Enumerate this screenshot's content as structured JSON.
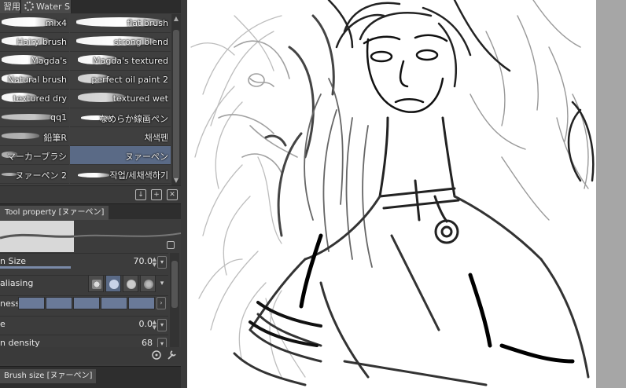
{
  "tabs": [
    {
      "label": "習用"
    },
    {
      "label": "Water S"
    }
  ],
  "brushes": [
    {
      "left": "mix4",
      "right": "flat brush"
    },
    {
      "left": "Hairy brush",
      "right": "strong blend"
    },
    {
      "left": "Magda's",
      "right": "Magda's textured"
    },
    {
      "left": "Natural brush",
      "right": "perfect oil paint 2"
    },
    {
      "left": "textured dry",
      "right": "textured wet"
    },
    {
      "left": "qq1",
      "right": "なめらか線画ペン"
    },
    {
      "left": "鉛筆R",
      "right": "채색펜"
    },
    {
      "left": "マーカーブラシ",
      "right": "ヌァーペン"
    },
    {
      "left": "ヌァーペン 2",
      "right": "작업/세채색하기"
    }
  ],
  "tool_property": {
    "tab_label": "Tool property [ヌァーペン]",
    "brush_size": {
      "label": "n Size",
      "value": "70.0",
      "fill": 0.5
    },
    "anti_aliasing": {
      "label": "aliasing",
      "selected_index": 1
    },
    "hardness": {
      "label": "ness",
      "segments": 5
    },
    "row4": {
      "label": "e",
      "value": "0.0"
    },
    "density": {
      "label": "n density",
      "value": "68"
    }
  },
  "brush_size_panel": {
    "tab_label": "Brush size [ヌァーペン]"
  },
  "colors": {
    "selection": "#5a6a86",
    "panel": "#3c3c3c",
    "canvas": "#ffffff",
    "strip": "#a6a6a6"
  }
}
